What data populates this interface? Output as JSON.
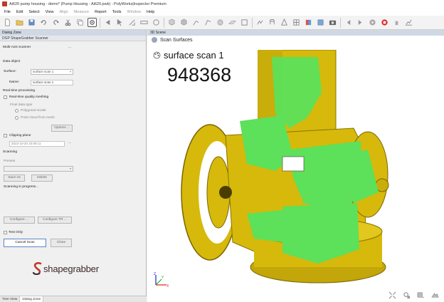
{
  "window": {
    "title": "Ai620 pump housing - demo* (Pump Housing - Ai620.pwk) - PolyWorks|Inspector Premium"
  },
  "menu": [
    {
      "label": "File",
      "enabled": true
    },
    {
      "label": "Edit",
      "enabled": true
    },
    {
      "label": "Select",
      "enabled": true
    },
    {
      "label": "View",
      "enabled": true
    },
    {
      "label": "Align",
      "enabled": false
    },
    {
      "label": "Measure",
      "enabled": false
    },
    {
      "label": "Report",
      "enabled": true
    },
    {
      "label": "Tools",
      "enabled": true
    },
    {
      "label": "Window",
      "enabled": false
    },
    {
      "label": "Help",
      "enabled": true
    }
  ],
  "dialog_zone": {
    "header": "Dialog Zone",
    "panel_title": "DGP ShapeGrabber Scanner",
    "multi_axis_label": "Multi-Axis scanner",
    "data_object_label": "Data object",
    "surface_label": "Surface:",
    "surface_value": "surface scan 1",
    "name_label": "Name:",
    "name_value": "surface scan 1",
    "realtime_label": "Real-time processing",
    "realtime_meshing_label": "Real-time quality meshing",
    "final_data_label": "Final data type",
    "polygonal_label": "Polygonal model",
    "point_cloud_label": "Point cloud from mesh",
    "options_label": "Options ...",
    "clipping_label": "Clipping plane",
    "clipping_value": "2022-10-20 10:09:11",
    "scanning_label": "Scanning",
    "presets_placeholder": "Presets",
    "save_as_label": "Save As",
    "delete_label": "Delete",
    "status_text": "Scanning in progress...",
    "configure_label": "Configure ...",
    "configure_tr_label": "Configure TR ...",
    "test_only_label": "Test Only",
    "cancel_scan_label": "Cancel Scan",
    "close_label": "Close",
    "logo_text": "shapegrabber",
    "logo_colors": {
      "s_red": "#c0392b",
      "s_dark": "#333333"
    },
    "tabs": [
      "Tree View",
      "Dialog Zone"
    ]
  },
  "scene": {
    "header": "3D Scene",
    "subheader": "Scan Surfaces",
    "object_label": "surface scan 1",
    "counter": "948368",
    "colors": {
      "part": "#d6b90b",
      "part_dark": "#8a7400",
      "scan": "#5de05a"
    }
  },
  "axes": {
    "x": "X",
    "y": "Y",
    "z": "Z"
  }
}
